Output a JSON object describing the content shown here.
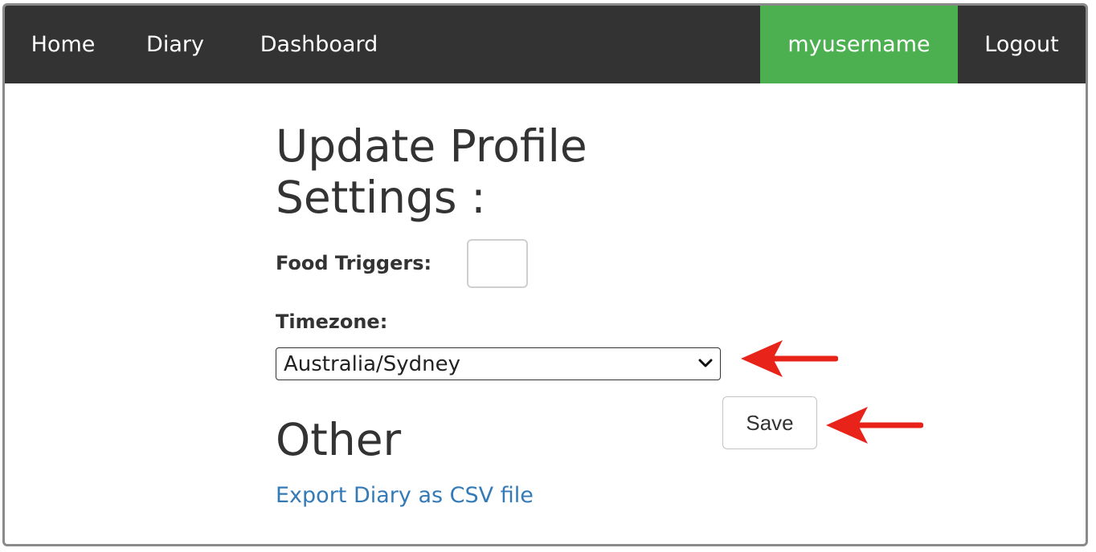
{
  "nav": {
    "home": "Home",
    "diary": "Diary",
    "dashboard": "Dashboard",
    "username": "myusername",
    "logout": "Logout"
  },
  "main": {
    "title": "Update Profile Settings :",
    "food_triggers_label": "Food Triggers:",
    "food_triggers_checked": false,
    "timezone_label": "Timezone:",
    "timezone_value": "Australia/Sydney",
    "save_label": "Save",
    "other_heading": "Other",
    "export_link": "Export Diary as CSV file"
  },
  "colors": {
    "navbar_bg": "#333333",
    "user_tab_bg": "#4caf50",
    "link": "#337ab7",
    "annotation_arrow": "#e8241a"
  },
  "icons": {
    "select_chevron": "chevron-down-icon",
    "annotations": [
      "arrow-left-icon",
      "arrow-left-icon"
    ]
  }
}
